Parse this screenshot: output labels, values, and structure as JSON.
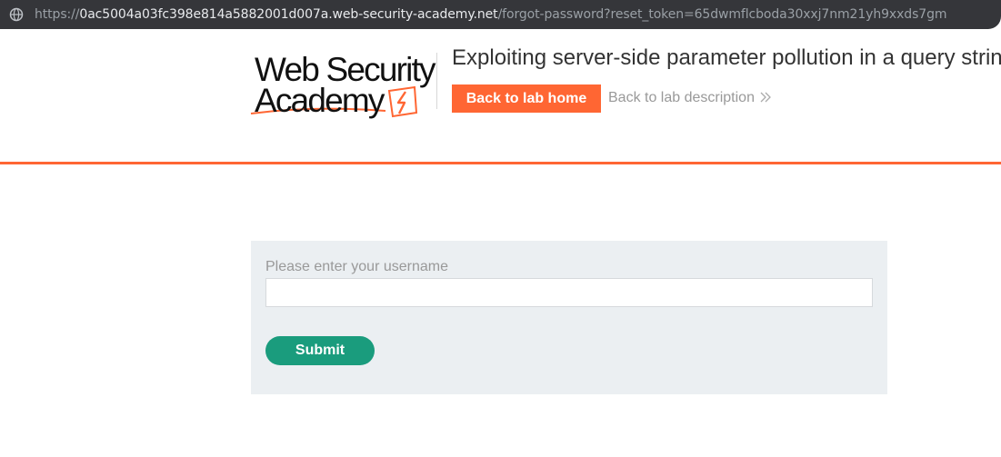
{
  "browser": {
    "url_scheme": "https://",
    "url_host": "0ac5004a03fc398e814a5882001d007a.web-security-academy.net",
    "url_path": "/forgot-password?reset_token=65dwmflcboda30xxj7nm21yh9xxds7gm",
    "site_icon": "globe-icon"
  },
  "header": {
    "logo_line1": "Web Security",
    "logo_line2": "Academy",
    "lab_title": "Exploiting server-side parameter pollution in a query string",
    "back_home_label": "Back to lab home",
    "back_description_label": "Back to lab description",
    "chevron_icon": "double-chevron-right-icon"
  },
  "form": {
    "username_label": "Please enter your username",
    "username_value": "",
    "submit_label": "Submit"
  },
  "colors": {
    "accent": "#ff6633",
    "submit": "#1a9c7d",
    "panel_bg": "#ebeff2",
    "urlbar_bg": "#35363a"
  }
}
